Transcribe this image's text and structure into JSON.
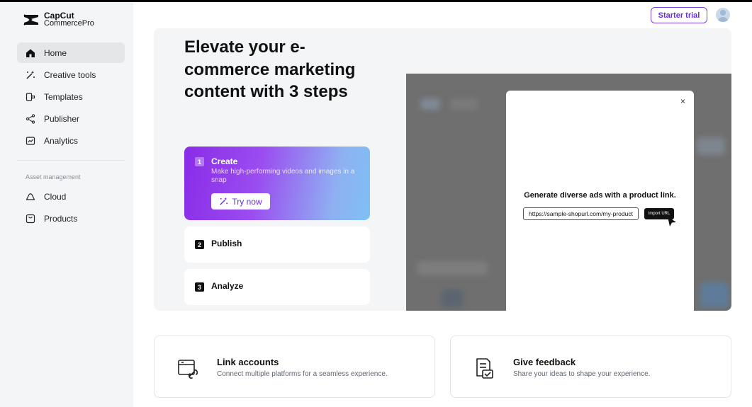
{
  "app": {
    "logo_line1": "CapCut",
    "logo_line2": "CommercePro"
  },
  "sidebar": {
    "items": [
      {
        "label": "Home",
        "icon": "home-icon",
        "active": true
      },
      {
        "label": "Creative tools",
        "icon": "magic-wand-icon"
      },
      {
        "label": "Templates",
        "icon": "templates-icon"
      },
      {
        "label": "Publisher",
        "icon": "share-icon"
      },
      {
        "label": "Analytics",
        "icon": "analytics-icon"
      }
    ],
    "section_label": "Asset management",
    "asset_items": [
      {
        "label": "Cloud",
        "icon": "cloud-icon"
      },
      {
        "label": "Products",
        "icon": "products-icon"
      }
    ]
  },
  "header": {
    "trial_label": "Starter trial",
    "avatar": "user-avatar-icon"
  },
  "hero": {
    "title": "Elevate your e-commerce marketing content with 3 steps",
    "steps": [
      {
        "num": "1",
        "title": "Create",
        "desc": "Make high-performing videos and images in a snap",
        "button": "Try now"
      },
      {
        "num": "2",
        "title": "Publish"
      },
      {
        "num": "3",
        "title": "Analyze"
      }
    ],
    "preview": {
      "close": "×",
      "modal_title": "Generate diverse ads with a product link.",
      "url_value": "https://sample-shopurl.com/my-product",
      "import_label": "Import URL"
    }
  },
  "cards": [
    {
      "title": "Link accounts",
      "desc": "Connect multiple platforms for a seamless experience.",
      "icon": "link-accounts-icon"
    },
    {
      "title": "Give feedback",
      "desc": "Share your ideas to shape your experience.",
      "icon": "feedback-icon"
    }
  ],
  "colors": {
    "accent": "#7b3fe4",
    "sidebar_bg": "#f4f5f6",
    "active_item_bg": "#e4e6e8"
  }
}
